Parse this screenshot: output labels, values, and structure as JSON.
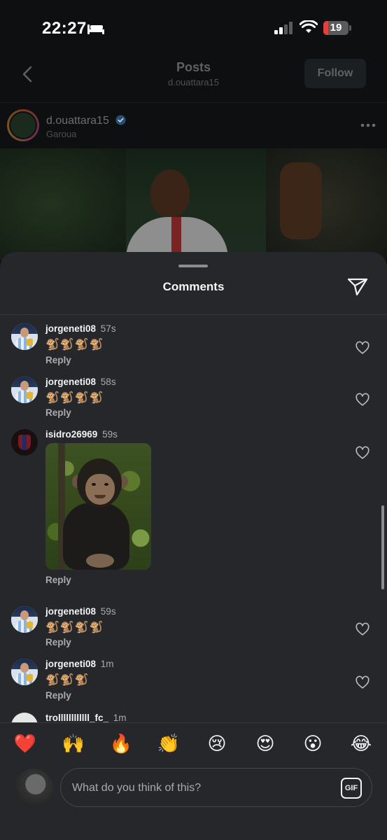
{
  "status_bar": {
    "time": "22:27",
    "battery_level": "19",
    "battery_fraction": 0.19,
    "icons": [
      "bed-icon",
      "signal-icon",
      "wifi-icon",
      "battery-icon"
    ]
  },
  "header": {
    "title": "Posts",
    "subtitle": "d.ouattara15",
    "follow_label": "Follow"
  },
  "post": {
    "username": "d.ouattara15",
    "verified": true,
    "location": "Garoua"
  },
  "comments_sheet": {
    "title": "Comments",
    "comments": [
      {
        "user": "jorgeneti08",
        "time": "57s",
        "text": "🐒🐒🐒🐒",
        "reply": "Reply"
      },
      {
        "user": "jorgeneti08",
        "time": "58s",
        "text": "🐒🐒🐒🐒",
        "reply": "Reply"
      },
      {
        "user": "isidro26969",
        "time": "59s",
        "media": "chimpanzee-gif",
        "reply": "Reply"
      },
      {
        "user": "jorgeneti08",
        "time": "59s",
        "text": "🐒🐒🐒🐒",
        "reply": "Reply"
      },
      {
        "user": "jorgeneti08",
        "time": "1m",
        "text": "🐒🐒🐒",
        "reply": "Reply"
      },
      {
        "user": "trollllllllllll_fc_",
        "time": "1m"
      }
    ]
  },
  "reactions": [
    "❤️",
    "🙌",
    "🔥",
    "👏",
    "😢",
    "😍",
    "😮",
    "😂"
  ],
  "composer": {
    "placeholder": "What do you think of this?",
    "gif_label": "GIF"
  },
  "colors": {
    "sheet_background": "#25272b",
    "page_background": "#0d0f11",
    "verified_blue": "#3897f0",
    "battery_red": "#e0413c"
  }
}
